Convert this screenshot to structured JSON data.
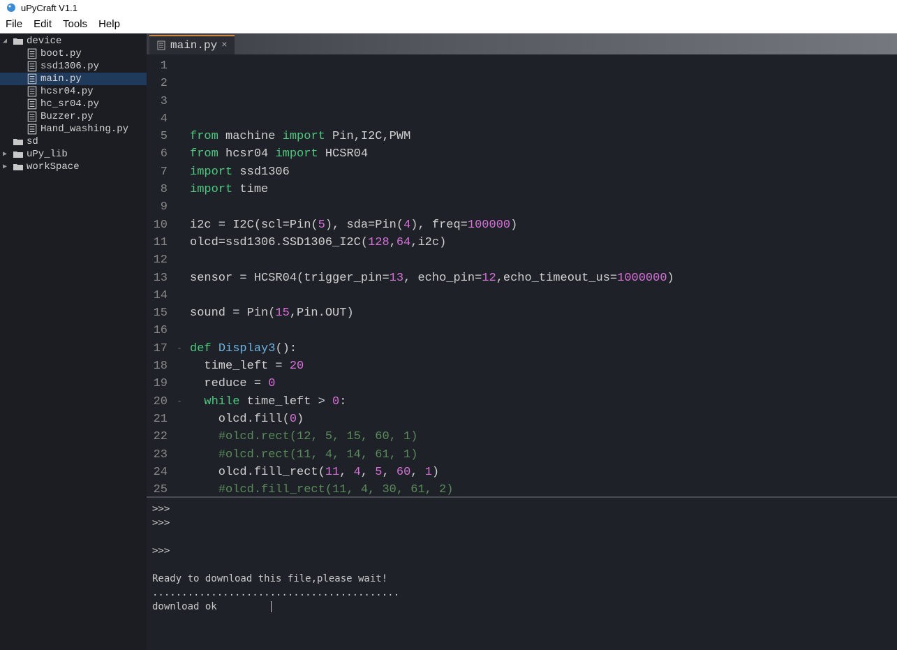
{
  "app": {
    "title": "uPyCraft V1.1"
  },
  "menu": {
    "file": "File",
    "edit": "Edit",
    "tools": "Tools",
    "help": "Help"
  },
  "sidebar": {
    "device": "device",
    "files": [
      "boot.py",
      "ssd1306.py",
      "main.py",
      "hcsr04.py",
      "hc_sr04.py",
      "Buzzer.py",
      "Hand_washing.py"
    ],
    "sd": "sd",
    "upy_lib": "uPy_lib",
    "workspace": "workSpace"
  },
  "tab": {
    "name": "main.py"
  },
  "code": {
    "lines": [
      {
        "n": 1,
        "t": ""
      },
      {
        "n": 2,
        "t": ""
      },
      {
        "n": 3,
        "t": ""
      },
      {
        "n": 4,
        "t": ""
      },
      {
        "n": 5,
        "seg": [
          {
            "c": "tok-kw",
            "t": "from"
          },
          {
            "t": " machine "
          },
          {
            "c": "tok-kw",
            "t": "import"
          },
          {
            "t": " Pin,I2C,PWM"
          }
        ]
      },
      {
        "n": 6,
        "seg": [
          {
            "c": "tok-kw",
            "t": "from"
          },
          {
            "t": " hcsr04 "
          },
          {
            "c": "tok-kw",
            "t": "import"
          },
          {
            "t": " HCSR04"
          }
        ]
      },
      {
        "n": 7,
        "seg": [
          {
            "c": "tok-kw",
            "t": "import"
          },
          {
            "t": " ssd1306"
          }
        ]
      },
      {
        "n": 8,
        "seg": [
          {
            "c": "tok-kw",
            "t": "import"
          },
          {
            "t": " time"
          }
        ]
      },
      {
        "n": 9,
        "t": ""
      },
      {
        "n": 10,
        "seg": [
          {
            "t": "i2c = I2C(scl=Pin("
          },
          {
            "c": "tok-num",
            "t": "5"
          },
          {
            "t": "), sda=Pin("
          },
          {
            "c": "tok-num",
            "t": "4"
          },
          {
            "t": "), freq="
          },
          {
            "c": "tok-num",
            "t": "100000"
          },
          {
            "t": ")"
          }
        ]
      },
      {
        "n": 11,
        "seg": [
          {
            "t": "olcd=ssd1306.SSD1306_I2C("
          },
          {
            "c": "tok-num",
            "t": "128"
          },
          {
            "t": ","
          },
          {
            "c": "tok-num",
            "t": "64"
          },
          {
            "t": ",i2c)"
          }
        ]
      },
      {
        "n": 12,
        "t": ""
      },
      {
        "n": 13,
        "seg": [
          {
            "t": "sensor = HCSR04(trigger_pin="
          },
          {
            "c": "tok-num",
            "t": "13"
          },
          {
            "t": ", echo_pin="
          },
          {
            "c": "tok-num",
            "t": "12"
          },
          {
            "t": ",echo_timeout_us="
          },
          {
            "c": "tok-num",
            "t": "1000000"
          },
          {
            "t": ")"
          }
        ]
      },
      {
        "n": 14,
        "t": ""
      },
      {
        "n": 15,
        "seg": [
          {
            "t": "sound = Pin("
          },
          {
            "c": "tok-num",
            "t": "15"
          },
          {
            "t": ",Pin.OUT)"
          }
        ]
      },
      {
        "n": 16,
        "t": ""
      },
      {
        "n": 17,
        "fold": "-",
        "seg": [
          {
            "c": "tok-kw",
            "t": "def"
          },
          {
            "t": " "
          },
          {
            "c": "tok-fn",
            "t": "Display3"
          },
          {
            "t": "():"
          }
        ]
      },
      {
        "n": 18,
        "seg": [
          {
            "t": "  time_left = "
          },
          {
            "c": "tok-num",
            "t": "20"
          }
        ]
      },
      {
        "n": 19,
        "seg": [
          {
            "t": "  reduce = "
          },
          {
            "c": "tok-num",
            "t": "0"
          }
        ]
      },
      {
        "n": 20,
        "fold": "-",
        "seg": [
          {
            "t": "  "
          },
          {
            "c": "tok-kw",
            "t": "while"
          },
          {
            "t": " time_left > "
          },
          {
            "c": "tok-num",
            "t": "0"
          },
          {
            "t": ":"
          }
        ]
      },
      {
        "n": 21,
        "seg": [
          {
            "t": "    olcd.fill("
          },
          {
            "c": "tok-num",
            "t": "0"
          },
          {
            "t": ")"
          }
        ]
      },
      {
        "n": 22,
        "seg": [
          {
            "t": "    "
          },
          {
            "c": "tok-cm",
            "t": "#olcd.rect(12, 5, 15, 60, 1)"
          }
        ]
      },
      {
        "n": 23,
        "seg": [
          {
            "t": "    "
          },
          {
            "c": "tok-cm",
            "t": "#olcd.rect(11, 4, 14, 61, 1)"
          }
        ]
      },
      {
        "n": 24,
        "seg": [
          {
            "t": "    olcd.fill_rect("
          },
          {
            "c": "tok-num",
            "t": "11"
          },
          {
            "t": ", "
          },
          {
            "c": "tok-num",
            "t": "4"
          },
          {
            "t": ", "
          },
          {
            "c": "tok-num",
            "t": "5"
          },
          {
            "t": ", "
          },
          {
            "c": "tok-num",
            "t": "60"
          },
          {
            "t": ", "
          },
          {
            "c": "tok-num",
            "t": "1"
          },
          {
            "t": ")"
          }
        ]
      },
      {
        "n": 25,
        "seg": [
          {
            "t": "    "
          },
          {
            "c": "tok-cm",
            "t": "#olcd.fill_rect(11, 4, 30, 61, 2)"
          }
        ]
      }
    ]
  },
  "console": {
    "lines": [
      ">>>",
      ">>>",
      "",
      ">>>",
      "",
      "Ready to download this file,please wait!",
      "..........................................",
      "download ok"
    ]
  }
}
